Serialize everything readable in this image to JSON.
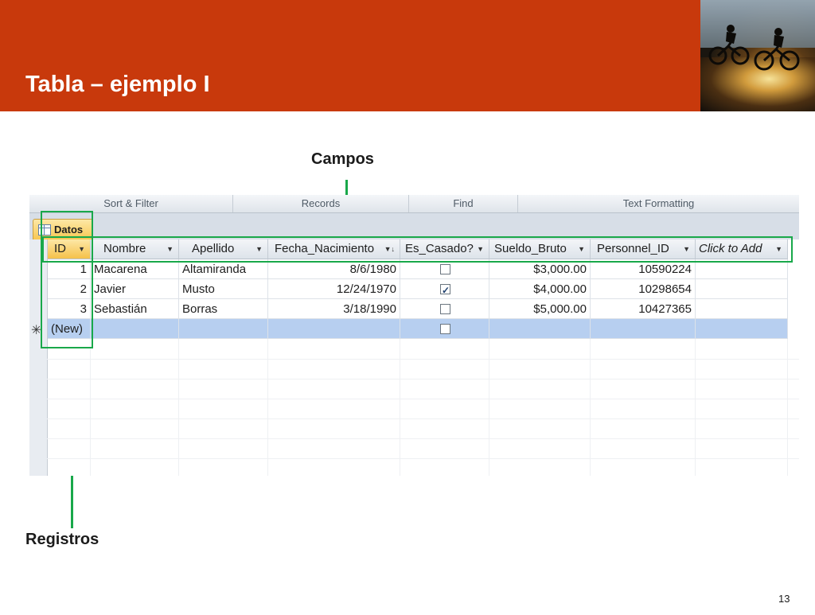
{
  "slide": {
    "title": "Tabla – ejemplo I",
    "callout_fields": "Campos",
    "callout_records": "Registros",
    "page_number": "13",
    "accent_color": "#c8390c",
    "annotation_color": "#19a84a"
  },
  "ribbon": {
    "groups": [
      "Sort & Filter",
      "Records",
      "Find",
      "Text Formatting"
    ]
  },
  "object_tab": {
    "label": "Datos",
    "icon": "table-icon"
  },
  "columns": [
    "ID",
    "Nombre",
    "Apellido",
    "Fecha_Nacimiento",
    "Es_Casado?",
    "Sueldo_Bruto",
    "Personnel_ID",
    "Click to Add"
  ],
  "rows": [
    {
      "id": "1",
      "nombre": "Macarena",
      "apellido": "Altamiranda",
      "fecha": "8/6/1980",
      "casado": false,
      "sueldo": "$3,000.00",
      "personnel": "10590224"
    },
    {
      "id": "2",
      "nombre": "Javier",
      "apellido": "Musto",
      "fecha": "12/24/1970",
      "casado": true,
      "sueldo": "$4,000.00",
      "personnel": "10298654"
    },
    {
      "id": "3",
      "nombre": "Sebastián",
      "apellido": "Borras",
      "fecha": "3/18/1990",
      "casado": false,
      "sueldo": "$5,000.00",
      "personnel": "10427365"
    }
  ],
  "new_row": {
    "id_label": "(New)",
    "selector_glyph": "✳",
    "casado": false
  }
}
